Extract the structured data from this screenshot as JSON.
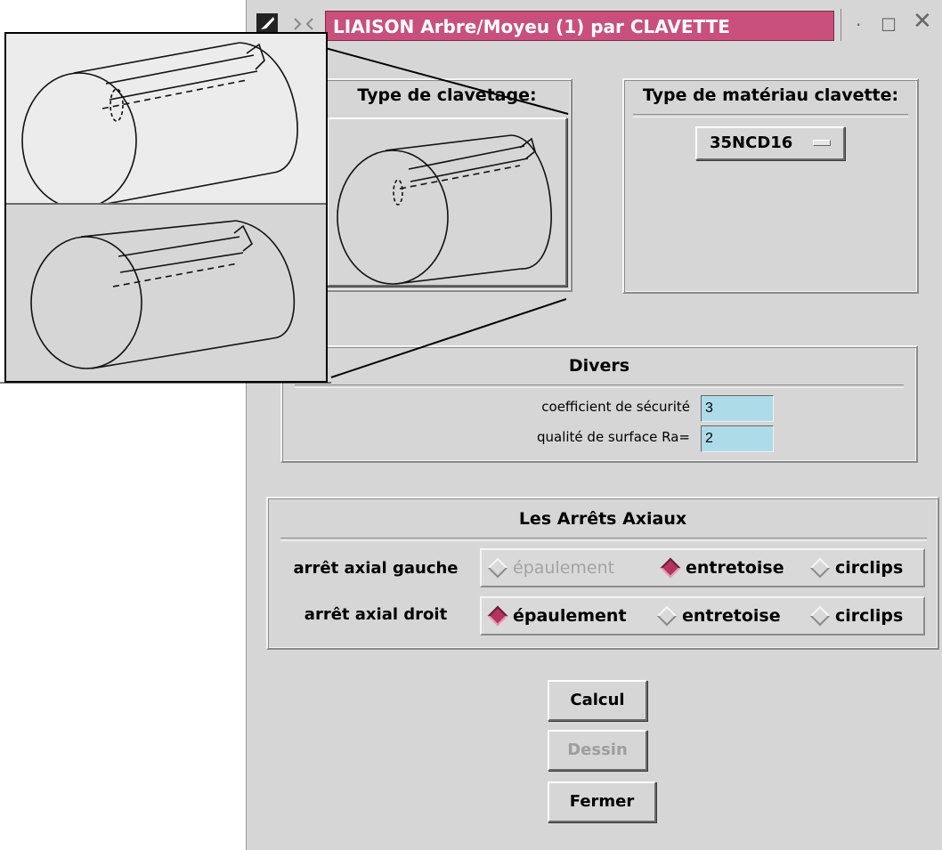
{
  "window": {
    "title": "LIAISON Arbre/Moyeu (1) par CLAVETTE",
    "controls": [
      "·",
      "☐",
      "✕"
    ]
  },
  "clavetage": {
    "title": "Type de clavetage:"
  },
  "materiau": {
    "title": "Type de matériau clavette:",
    "selected": "35NCD16"
  },
  "divers": {
    "title": "Divers",
    "fields": [
      {
        "label": "coefficient de sécurité",
        "value": "3"
      },
      {
        "label": "qualité de surface Ra=",
        "value": "2"
      }
    ]
  },
  "arrets": {
    "title": "Les Arrêts Axiaux",
    "rows": [
      {
        "label": "arrêt axial gauche",
        "options": [
          {
            "label": "épaulement",
            "selected": false,
            "enabled": false
          },
          {
            "label": "entretoise",
            "selected": true,
            "enabled": true
          },
          {
            "label": "circlips",
            "selected": false,
            "enabled": true
          }
        ]
      },
      {
        "label": "arrêt axial droit",
        "options": [
          {
            "label": "épaulement",
            "selected": true,
            "enabled": true
          },
          {
            "label": "entretoise",
            "selected": false,
            "enabled": true
          },
          {
            "label": "circlips",
            "selected": false,
            "enabled": true
          }
        ]
      }
    ]
  },
  "buttons": {
    "calcul": {
      "label": "Calcul",
      "enabled": true
    },
    "dessin": {
      "label": "Dessin",
      "enabled": false
    },
    "fermer": {
      "label": "Fermer",
      "enabled": true
    }
  },
  "icons": {
    "window_menu": "tool-icon",
    "key_shape": "cylinder-keyway-icon"
  },
  "colors": {
    "window_bg": "#d6d6d6",
    "title_active": "#c94f7c",
    "radio_selected": "#b5335f",
    "field_bg": "#aedbe8"
  }
}
